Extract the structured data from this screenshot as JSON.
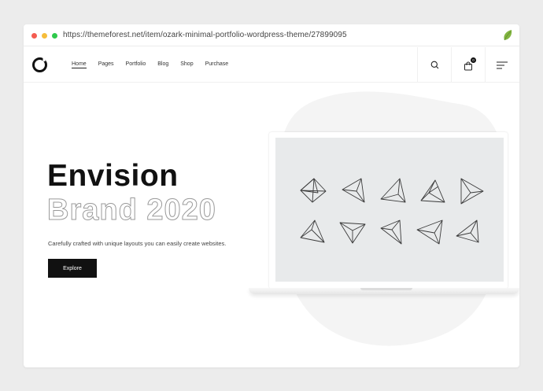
{
  "browser": {
    "url": "https://themeforest.net/item/ozark-minimal-portfolio-wordpress-theme/27899095"
  },
  "nav": {
    "items": [
      {
        "label": "Home",
        "active": true
      },
      {
        "label": "Pages",
        "active": false
      },
      {
        "label": "Portfolio",
        "active": false
      },
      {
        "label": "Blog",
        "active": false
      },
      {
        "label": "Shop",
        "active": false
      },
      {
        "label": "Purchase",
        "active": false
      }
    ],
    "cart_count": "0",
    "icons": [
      "logo-icon",
      "search-icon",
      "cart-icon",
      "menu-icon"
    ]
  },
  "hero": {
    "title": "Envision",
    "subtitle": "Brand 2020",
    "description": "Carefully crafted with unique layouts you can easily create websites.",
    "button_label": "Explore"
  },
  "colors": {
    "accent": "#111111",
    "outline_text": "#9a9a9a",
    "screen_bg": "#e8eaeb",
    "page_bg": "#ececec"
  }
}
